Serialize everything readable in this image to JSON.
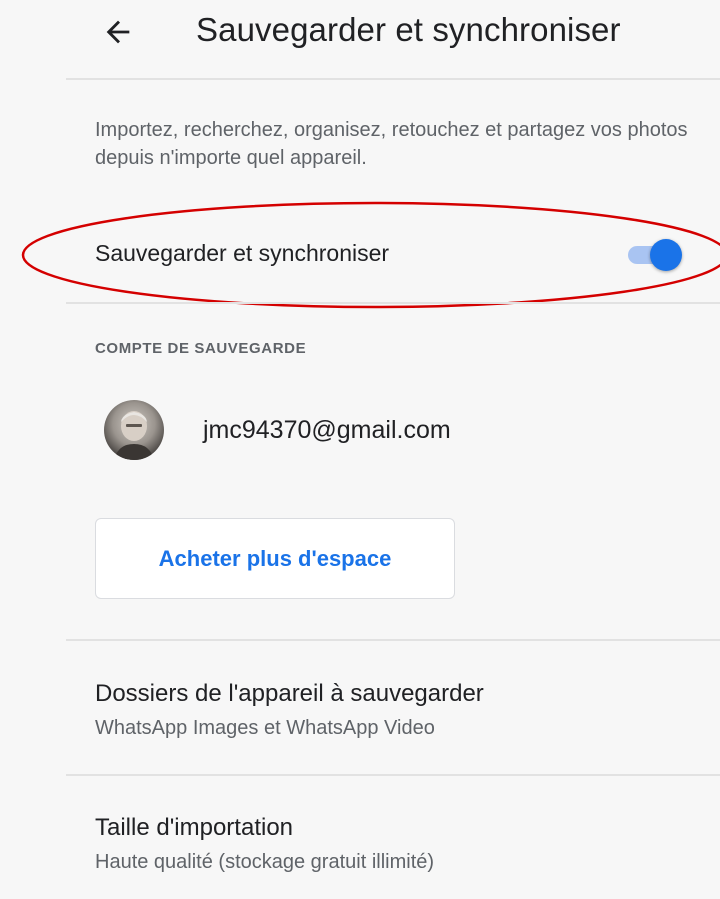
{
  "header": {
    "title": "Sauvegarder et synchroniser",
    "back_icon": "arrow-left-icon"
  },
  "intro": {
    "text": "Importez, recherchez, organisez, retouchez et partagez vos photos depuis n'importe quel appareil."
  },
  "sync": {
    "label": "Sauvegarder et synchroniser",
    "enabled": true,
    "toggle_color": "#1a73e8",
    "highlight_color": "#d40000"
  },
  "account": {
    "section_title": "COMPTE DE SAUVEGARDE",
    "email": "jmc94370@gmail.com"
  },
  "storage": {
    "buy_label": "Acheter plus d'espace"
  },
  "settings": [
    {
      "title": "Dossiers de l'appareil à sauvegarder",
      "subtitle": "WhatsApp Images et WhatsApp Video"
    },
    {
      "title": "Taille d'importation",
      "subtitle": "Haute qualité (stockage gratuit illimité)"
    }
  ]
}
